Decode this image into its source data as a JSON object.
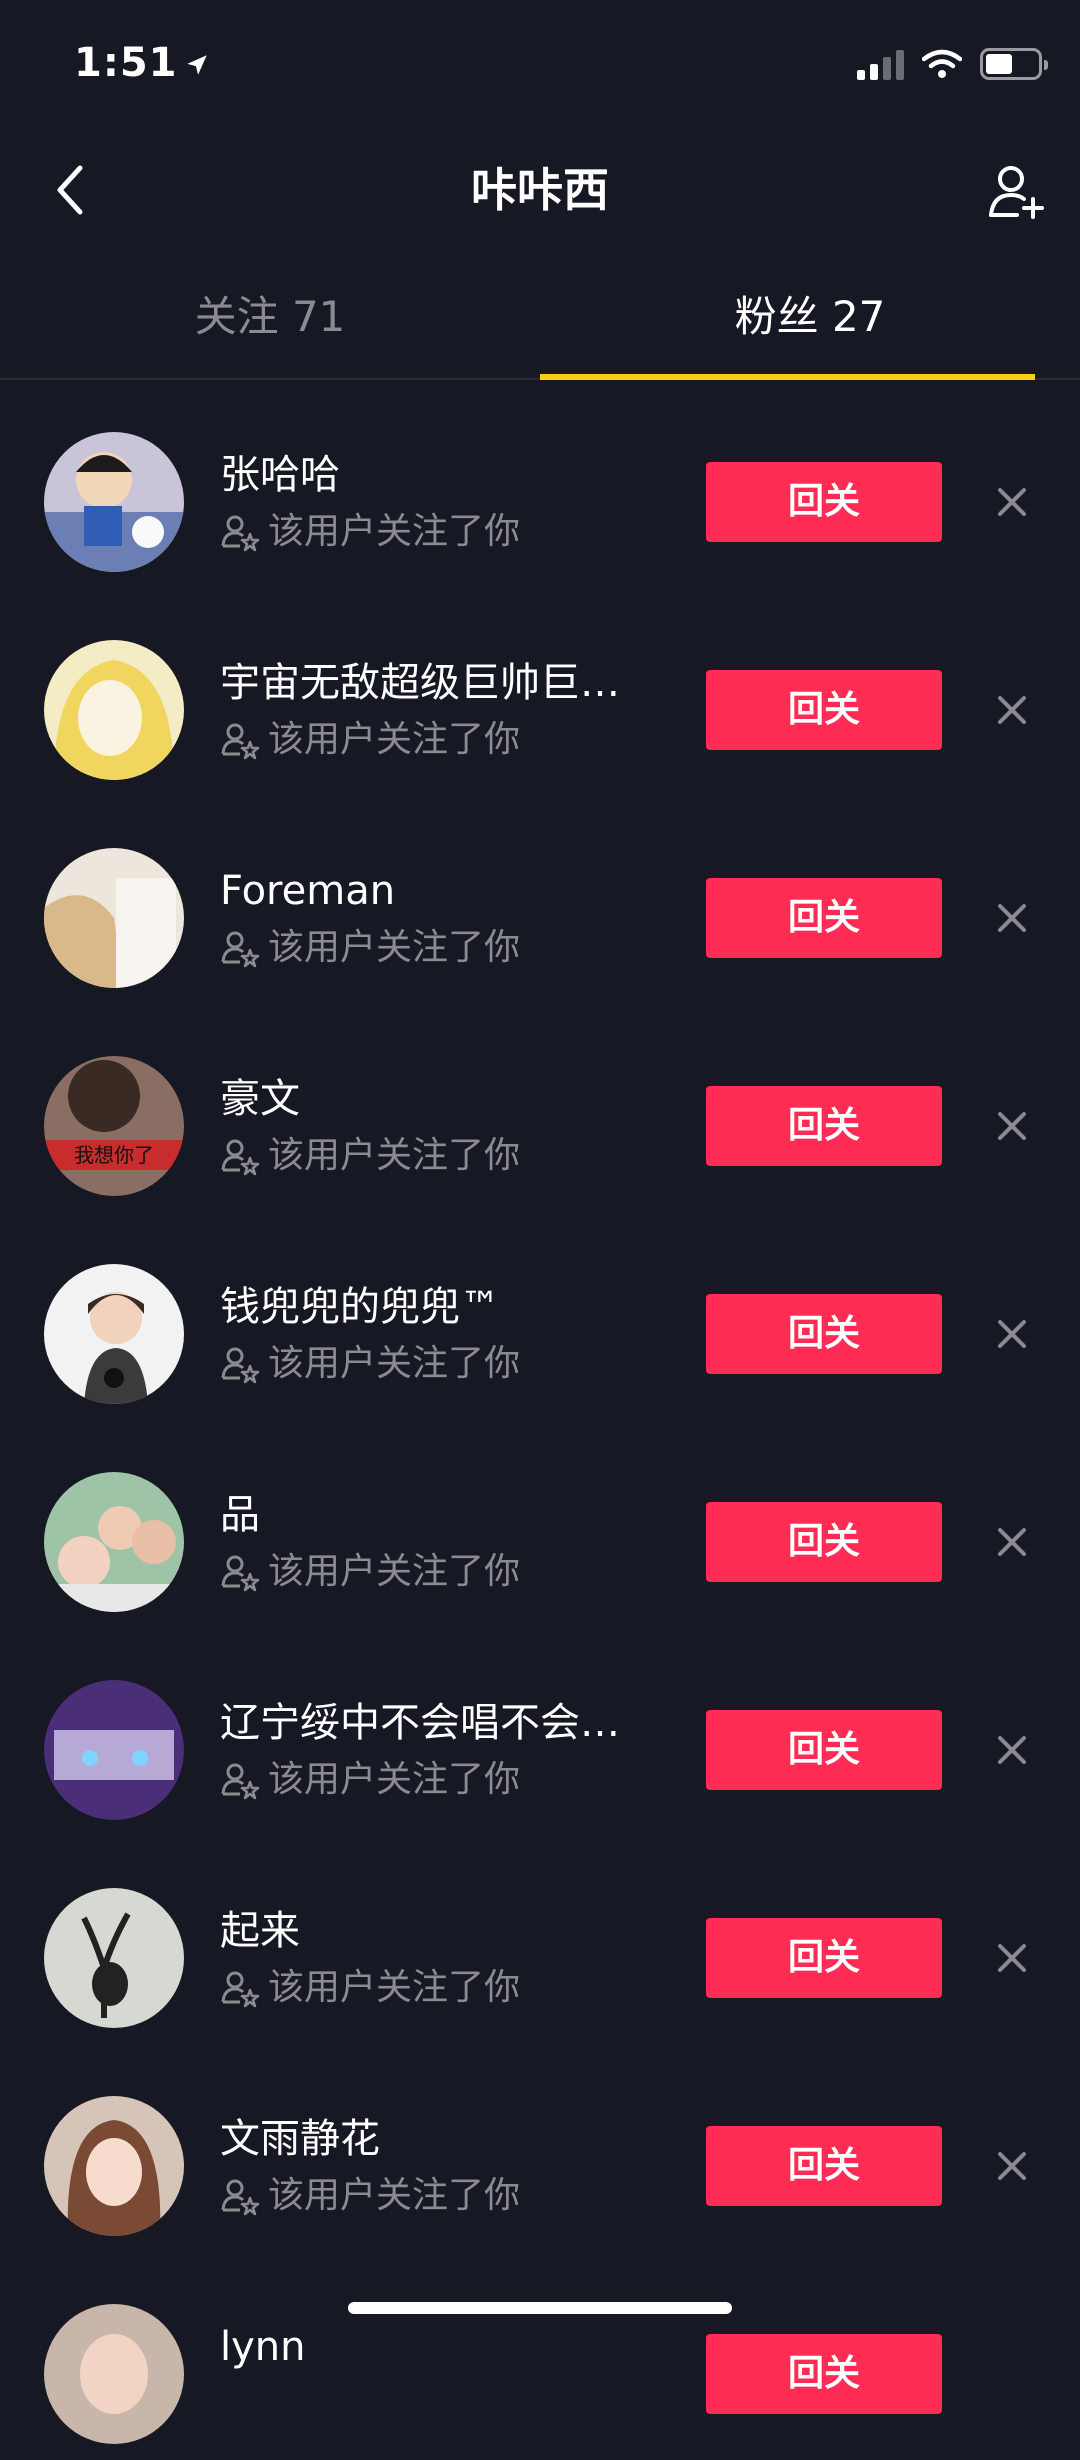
{
  "status_bar": {
    "time": "1:51"
  },
  "header": {
    "title": "咔咔西"
  },
  "tabs": [
    {
      "label": "关注 71",
      "active": false
    },
    {
      "label": "粉丝 27",
      "active": true
    }
  ],
  "follow_back_label": "回关",
  "followers": [
    {
      "name": "张哈哈",
      "subtitle": "该用户关注了你"
    },
    {
      "name": "宇宙无敌超级巨帅巨…",
      "subtitle": "该用户关注了你"
    },
    {
      "name": "Foreman",
      "subtitle": "该用户关注了你"
    },
    {
      "name": "豪文",
      "subtitle": "该用户关注了你",
      "avatar_text": "我想你了"
    },
    {
      "name": "钱兜兜的兜兜™",
      "subtitle": "该用户关注了你"
    },
    {
      "name": "品",
      "subtitle": "该用户关注了你"
    },
    {
      "name": "辽宁绥中不会唱不会…",
      "subtitle": "该用户关注了你"
    },
    {
      "name": "起来",
      "subtitle": "该用户关注了你"
    },
    {
      "name": "文雨静花",
      "subtitle": "该用户关注了你"
    },
    {
      "name": "lynn",
      "subtitle": ""
    }
  ],
  "colors": {
    "background": "#161823",
    "accent_button": "#fe2c55",
    "tab_indicator": "#face15",
    "secondary_text": "#8a8b91"
  }
}
